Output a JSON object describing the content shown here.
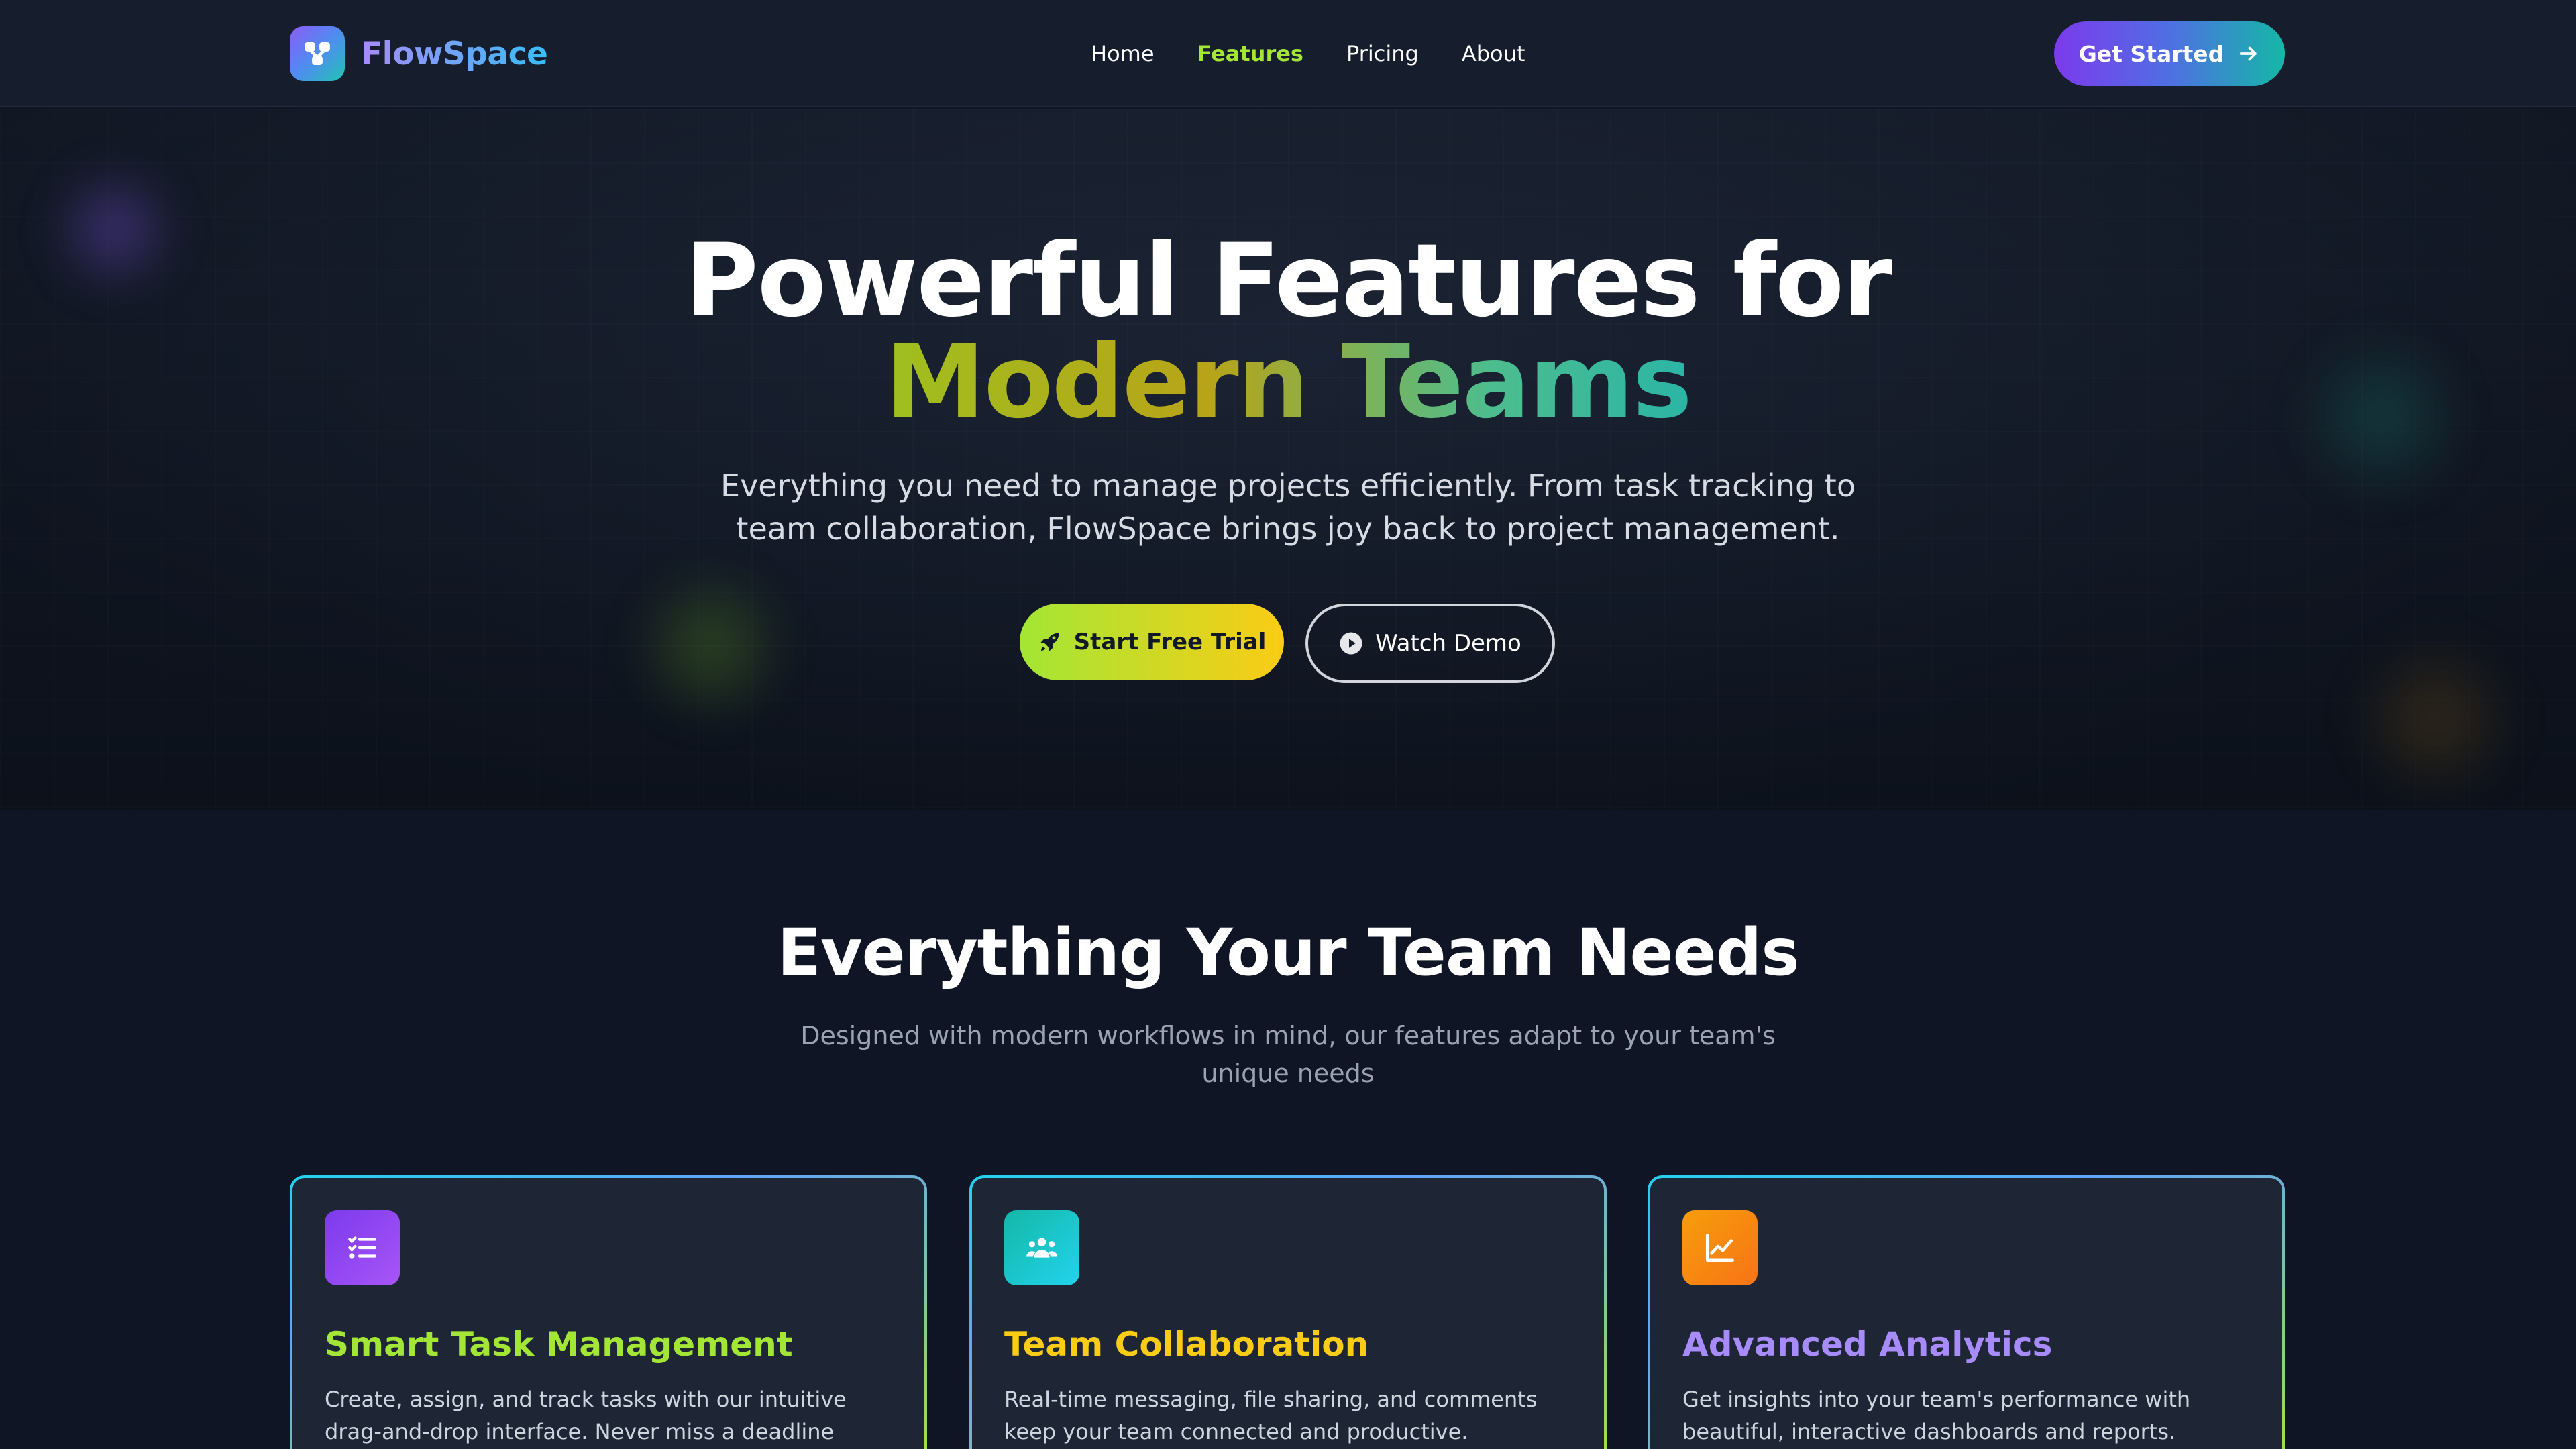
{
  "nav": {
    "brand": "FlowSpace",
    "links": [
      {
        "label": "Home",
        "active": false
      },
      {
        "label": "Features",
        "active": true
      },
      {
        "label": "Pricing",
        "active": false
      },
      {
        "label": "About",
        "active": false
      }
    ],
    "cta": "Get Started"
  },
  "hero": {
    "title_line1": "Powerful Features for",
    "title_line2": "Modern Teams",
    "subtitle": "Everything you need to manage projects efficiently. From task tracking to team collaboration, FlowSpace brings joy back to project management.",
    "primary_button": "Start Free Trial",
    "secondary_button": "Watch Demo"
  },
  "features": {
    "title": "Everything Your Team Needs",
    "subtitle": "Designed with modern workflows in mind, our features adapt to your team's unique needs",
    "cards": [
      {
        "title": "Smart Task Management",
        "text": "Create, assign, and track tasks with our intuitive drag-and-drop interface. Never miss a deadline again.",
        "icon": "task-list-icon",
        "title_color": "#a3e635",
        "icon_gradient": [
          "#7c3aed",
          "#a855f7"
        ]
      },
      {
        "title": "Team Collaboration",
        "text": "Real-time messaging, file sharing, and comments keep your team connected and productive.",
        "icon": "users-icon",
        "title_color": "#facc15",
        "icon_gradient": [
          "#14b8a6",
          "#22d3ee"
        ]
      },
      {
        "title": "Advanced Analytics",
        "text": "Get insights into your team's performance with beautiful, interactive dashboards and reports.",
        "icon": "chart-line-icon",
        "title_color": "#a78bfa",
        "icon_gradient": [
          "#f59e0b",
          "#f97316"
        ]
      }
    ]
  },
  "colors": {
    "background": "#0f1524",
    "accent_green": "#a3e635",
    "accent_yellow": "#facc15",
    "accent_purple": "#7c3aed",
    "accent_teal": "#14b8a6"
  }
}
